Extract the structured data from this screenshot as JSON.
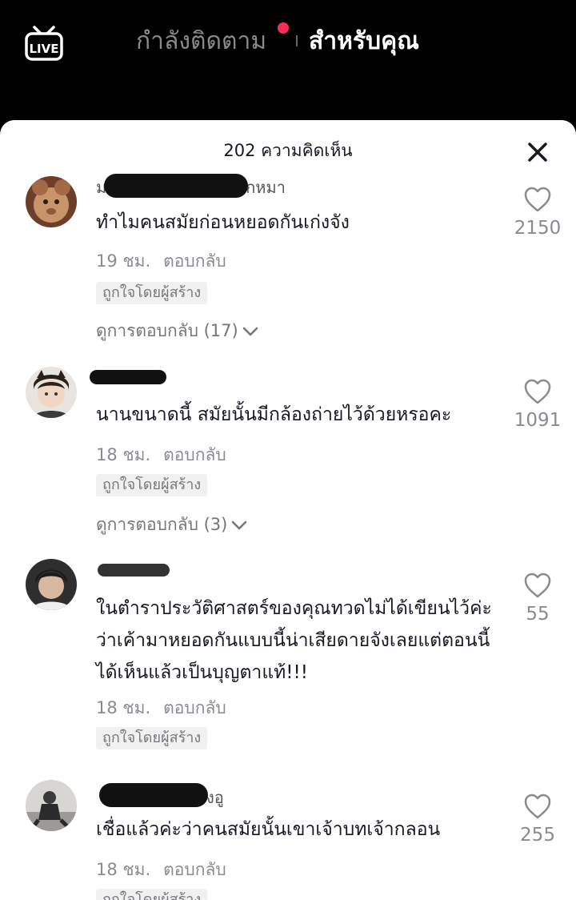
{
  "top_bar": {
    "live_icon": "live-tv-icon",
    "tab_following": "กำลังติดตาม",
    "tab_for_you": "สำหรับคุณ",
    "notification_color": "#fe2c55"
  },
  "comments_sheet": {
    "title": "202 ความคิดเห็น",
    "close_icon": "close-icon",
    "comments": [
      {
        "username_visible": "ม",
        "username_suffix": "กหมา",
        "text": "ทำไมคนสมัยก่อนหยอดกันเก่งจัง",
        "time": "19 ชม.",
        "reply_label": "ตอบกลับ",
        "badge": "ถูกใจโดยผู้สร้าง",
        "view_replies": "ดูการตอบกลับ (17)",
        "likes": "2150"
      },
      {
        "username_visible": "",
        "username_suffix": "",
        "text": "นานขนาดนี้ สมัยนั้นมีกล้องถ่ายไว้ด้วยหรอคะ",
        "time": "18 ชม.",
        "reply_label": "ตอบกลับ",
        "badge": "ถูกใจโดยผู้สร้าง",
        "view_replies": "ดูการตอบกลับ (3)",
        "likes": "1091"
      },
      {
        "username_visible": "",
        "username_suffix": "",
        "text": "ในตำราประวัติศาสตร์ของคุณทวดไม่ได้เขียนไว้ค่ะว่าเค้ามาหยอดกันแบบนี้น่าเสียดายจังเลยแต่ตอนนี้ได้เห็นแล้วเป็นบุญตาแท้!!!",
        "time": "18 ชม.",
        "reply_label": "ตอบกลับ",
        "badge": "ถูกใจโดยผู้สร้าง",
        "likes": "55"
      },
      {
        "username_visible": "",
        "username_suffix": "งอู",
        "text": "เชื่อแล้วค่ะว่าคนสมัยนั้นเขาเจ้าบทเจ้ากลอน",
        "time": "18 ชม.",
        "reply_label": "ตอบกลับ",
        "badge": "ถูกใจโดยผู้สร้าง",
        "likes": "255"
      }
    ]
  }
}
